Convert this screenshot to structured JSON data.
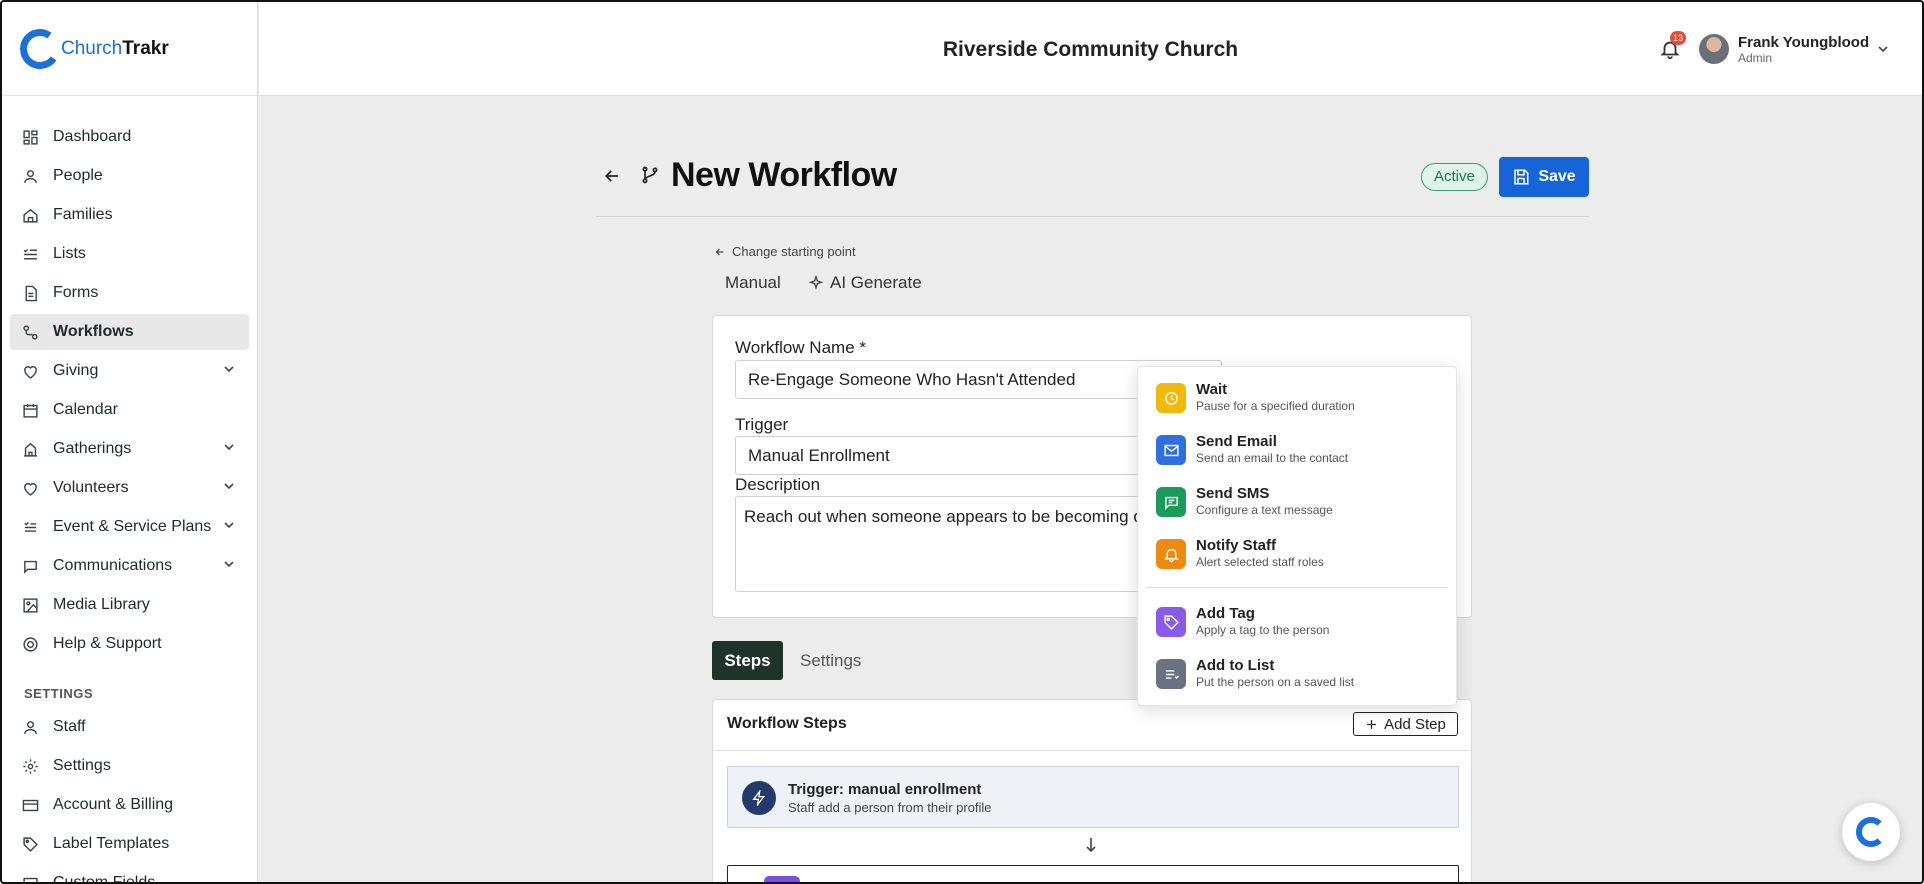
{
  "brand": {
    "name_part1": "Church",
    "name_part2": "Trakr",
    "color": "#1a6fd8"
  },
  "header": {
    "church_name": "Riverside Community Church",
    "notifications_count": "13",
    "user_name": "Frank Youngblood",
    "user_role": "Admin"
  },
  "sidebar": {
    "items": [
      {
        "label": "Dashboard",
        "icon": "dashboard-icon"
      },
      {
        "label": "People",
        "icon": "person-icon"
      },
      {
        "label": "Families",
        "icon": "home-icon"
      },
      {
        "label": "Lists",
        "icon": "list-icon"
      },
      {
        "label": "Forms",
        "icon": "form-icon"
      },
      {
        "label": "Workflows",
        "icon": "workflow-icon",
        "active": true
      },
      {
        "label": "Giving",
        "icon": "heart-icon",
        "expandable": true
      },
      {
        "label": "Calendar",
        "icon": "calendar-icon"
      },
      {
        "label": "Gatherings",
        "icon": "gatherings-icon",
        "expandable": true
      },
      {
        "label": "Volunteers",
        "icon": "volunteers-icon",
        "expandable": true
      },
      {
        "label": "Event & Service Plans",
        "icon": "plans-icon",
        "expandable": true
      },
      {
        "label": "Communications",
        "icon": "communications-icon",
        "expandable": true
      },
      {
        "label": "Media Library",
        "icon": "image-icon"
      },
      {
        "label": "Help & Support",
        "icon": "help-icon"
      }
    ],
    "settings_label": "SETTINGS",
    "settings_items": [
      {
        "label": "Staff",
        "icon": "staff-icon"
      },
      {
        "label": "Settings",
        "icon": "gear-icon"
      },
      {
        "label": "Account & Billing",
        "icon": "billing-icon"
      },
      {
        "label": "Label Templates",
        "icon": "tag-icon"
      },
      {
        "label": "Custom Fields",
        "icon": "fields-icon"
      }
    ]
  },
  "page": {
    "title": "New Workflow",
    "status": "Active",
    "save_label": "Save",
    "change_start": "Change starting point",
    "mode_tabs": {
      "manual": "Manual",
      "ai": "AI Generate"
    }
  },
  "form": {
    "name_label": "Workflow Name *",
    "name_value": "Re-Engage Someone Who Hasn't Attended",
    "trigger_label": "Trigger",
    "trigger_value": "Manual Enrollment",
    "description_label": "Description",
    "description_value": "Reach out when someone appears to be becoming d"
  },
  "tabs": {
    "steps": "Steps",
    "settings": "Settings"
  },
  "steps": {
    "heading": "Workflow Steps",
    "add_step": "Add Step",
    "trigger_title": "Trigger: manual enrollment",
    "trigger_sub": "Staff add a person from their profile"
  },
  "menu": {
    "items": [
      {
        "title": "Wait",
        "sub": "Pause for a specified duration",
        "icon": "clock-icon",
        "color": "#f2b90d"
      },
      {
        "title": "Send Email",
        "sub": "Send an email to the contact",
        "icon": "mail-icon",
        "color": "#2f6fe0"
      },
      {
        "title": "Send SMS",
        "sub": "Configure a text message",
        "icon": "message-icon",
        "color": "#1c9a5c"
      },
      {
        "title": "Notify Staff",
        "sub": "Alert selected staff roles",
        "icon": "bell-icon",
        "color": "#ec8a12"
      },
      {
        "title": "Add Tag",
        "sub": "Apply a tag to the person",
        "icon": "tag-icon",
        "color": "#8a5ae8"
      },
      {
        "title": "Add to List",
        "sub": "Put the person on a saved list",
        "icon": "list-add-icon",
        "color": "#6a7282"
      }
    ]
  }
}
